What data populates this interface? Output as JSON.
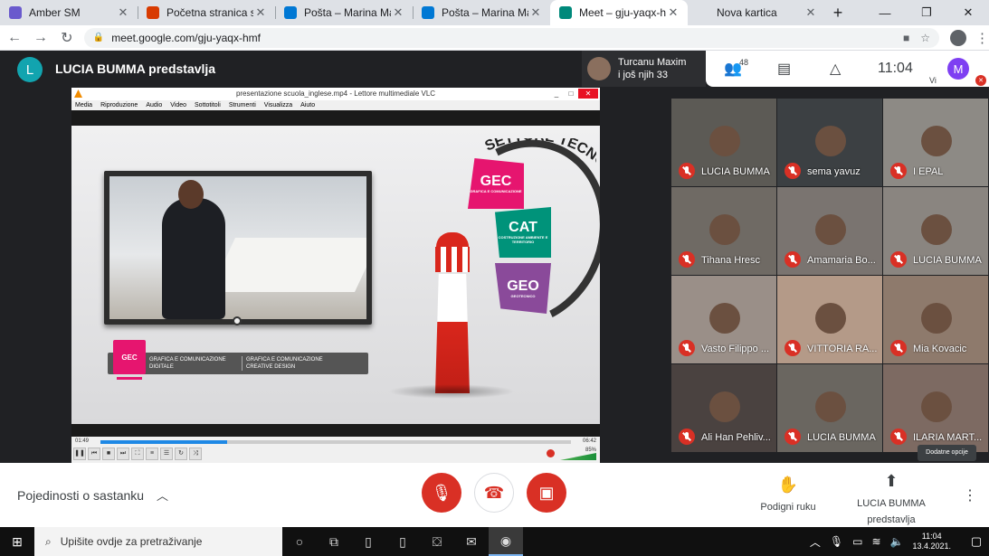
{
  "browser": {
    "tabs": [
      {
        "title": "Amber SM",
        "favicon": "person-icon",
        "color": "#6a5acd",
        "active": false
      },
      {
        "title": "Početna stranica sustava",
        "favicon": "office-icon",
        "color": "#d83b01",
        "active": false
      },
      {
        "title": "Pošta – Marina Mavričević",
        "favicon": "outlook-icon",
        "color": "#0078d4",
        "active": false
      },
      {
        "title": "Pošta – Marina Mavričević",
        "favicon": "outlook-icon",
        "color": "#0078d4",
        "active": false
      },
      {
        "title": "Meet – gju-yaqx-hmf",
        "favicon": "meet-icon",
        "color": "#00897b",
        "active": true
      },
      {
        "title": "Nova kartica",
        "favicon": "",
        "color": "#dee1e6",
        "active": false
      }
    ],
    "url": "meet.google.com/gju-yaqx-hmf"
  },
  "meet": {
    "presenter_initial": "L",
    "presenter_title": "LUCIA BUMMA predstavlja",
    "speaker_name": "Turcanu Maxim",
    "speaker_more": "i još njih 33",
    "participants_count": "48",
    "clock": "11:04",
    "self_initial": "M",
    "self_label": "Vi",
    "more_options_tooltip": "Dodatne opcije"
  },
  "vlc": {
    "title": "presentazione scuola_inglese.mp4 - Lettore multimediale VLC",
    "menu": [
      "Media",
      "Riproduzione",
      "Audio",
      "Video",
      "Sottotitoli",
      "Strumenti",
      "Visualizza",
      "Aiuto"
    ],
    "time_elapsed": "01:49",
    "time_total": "06:42",
    "progress": 0.27,
    "volume": "85%",
    "slide": {
      "heading": "SETTORE TECNOLOGICO",
      "gec": "GEC",
      "gec_sub": "GRAFICA E COMUNICAZIONE",
      "cat": "CAT",
      "cat_sub": "COSTRUZIONE AMBIENTE E TERRITORIO",
      "geo": "GEO",
      "geo_sub": "GEOTECNICO",
      "bar_logo": "GEC",
      "bar_left": "GRAFICA E COMUNICAZIONE DIGITALE",
      "bar_right": "GRAFICA E COMUNICAZIONE CREATIVE DESIGN"
    }
  },
  "participants": [
    {
      "name": "LUCIA BUMMA",
      "bg": "#5c5a55"
    },
    {
      "name": "sema yavuz",
      "bg": "#3c4043"
    },
    {
      "name": "I EPAL",
      "bg": "#8d8a85"
    },
    {
      "name": "Tihana Hresc",
      "bg": "#6f6a64"
    },
    {
      "name": "Amamaria Bo...",
      "bg": "#7a7470"
    },
    {
      "name": "LUCIA BUMMA",
      "bg": "#8a8580"
    },
    {
      "name": "Vasto Filippo ...",
      "bg": "#9a8f88"
    },
    {
      "name": "VITTORIA RA...",
      "bg": "#b49a88"
    },
    {
      "name": "Mia Kovacic",
      "bg": "#8e7a6c"
    },
    {
      "name": "Ali Han Pehliv...",
      "bg": "#4a4240"
    },
    {
      "name": "LUCIA BUMMA",
      "bg": "#6a6660"
    },
    {
      "name": "ILARIA MART...",
      "bg": "#7d6a62"
    }
  ],
  "bottom": {
    "meeting_details": "Pojedinosti o sastanku",
    "raise_hand": "Podigni ruku",
    "presenting": "LUCIA BUMMA predstavlja"
  },
  "taskbar": {
    "search_placeholder": "Upišite ovdje za pretraživanje",
    "time": "11:04",
    "date": "13.4.2021."
  }
}
